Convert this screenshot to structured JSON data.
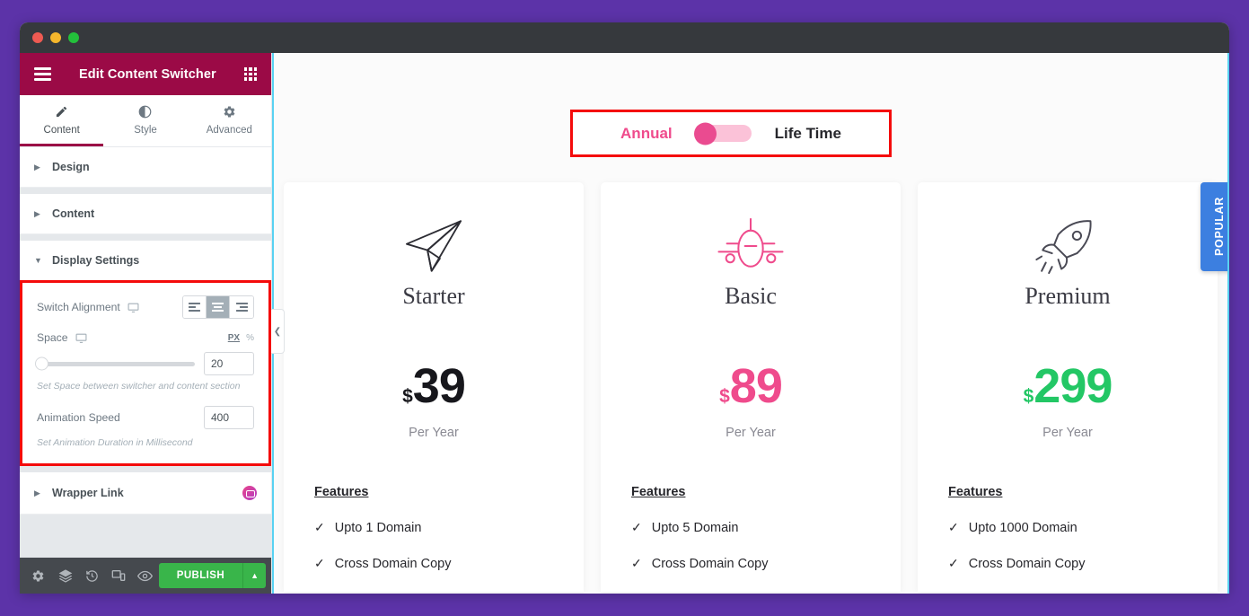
{
  "window": {
    "traffic_lights": [
      "close",
      "minimize",
      "maximize"
    ]
  },
  "panel": {
    "header": {
      "title": "Edit Content Switcher",
      "menu_icon": "hamburger-menu-icon",
      "grid_icon": "apps-grid-icon"
    },
    "tabs": [
      {
        "label": "Content",
        "icon": "pencil-icon",
        "active": true
      },
      {
        "label": "Style",
        "icon": "contrast-circle-icon",
        "active": false
      },
      {
        "label": "Advanced",
        "icon": "gear-icon",
        "active": false
      }
    ],
    "sections": [
      {
        "label": "Design",
        "expanded": false
      },
      {
        "label": "Content",
        "expanded": false
      },
      {
        "label": "Display Settings",
        "expanded": true
      },
      {
        "label": "Wrapper Link",
        "expanded": false,
        "pro_badge": true
      }
    ],
    "display_settings": {
      "switch_alignment": {
        "label": "Switch Alignment",
        "responsive_icon": "desktop-icon",
        "options": [
          "align-left",
          "align-center",
          "align-right"
        ],
        "selected": "align-center"
      },
      "space": {
        "label": "Space",
        "responsive_icon": "desktop-icon",
        "units": [
          "PX",
          "%"
        ],
        "active_unit": "PX",
        "value": "20",
        "hint": "Set Space between switcher and content section"
      },
      "animation_speed": {
        "label": "Animation Speed",
        "value": "400",
        "hint": "Set Animation Duration in Millisecond"
      }
    },
    "footer": {
      "icons": [
        "gear-icon",
        "layers-icon",
        "history-icon",
        "responsive-mode-icon",
        "preview-eye-icon"
      ],
      "publish_label": "PUBLISH",
      "publish_caret": "chevron-up-icon"
    },
    "collapse_handle": "chevron-left-icon"
  },
  "canvas": {
    "switcher": {
      "left_label": "Annual",
      "right_label": "Life Time",
      "state": "left",
      "knob_color": "#ea4b90",
      "track_color": "#fbc2d8",
      "left_label_color": "#ef4b8c",
      "right_label_color": "#27272c"
    },
    "cards": [
      {
        "icon": "paper-plane-icon",
        "icon_color": "#2c2c33",
        "name": "Starter",
        "currency": "$",
        "amount": "39",
        "price_color": "#17171c",
        "period": "Per Year",
        "features_title": "Features",
        "features": [
          "Upto 1 Domain",
          "Cross Domain Copy"
        ],
        "badge": null
      },
      {
        "icon": "airplane-icon",
        "icon_color": "#ef4b8c",
        "name": "Basic",
        "currency": "$",
        "amount": "89",
        "price_color": "#ef4b8c",
        "period": "Per Year",
        "features_title": "Features",
        "features": [
          "Upto 5 Domain",
          "Cross Domain Copy"
        ],
        "badge": null
      },
      {
        "icon": "rocket-icon",
        "icon_color": "#4a4a55",
        "name": "Premium",
        "currency": "$",
        "amount": "299",
        "price_color": "#23c765",
        "period": "Per Year",
        "features_title": "Features",
        "features": [
          "Upto 1000 Domain",
          "Cross Domain Copy"
        ],
        "badge": {
          "text": "POPULAR",
          "color": "#3c7fe0"
        }
      }
    ]
  }
}
